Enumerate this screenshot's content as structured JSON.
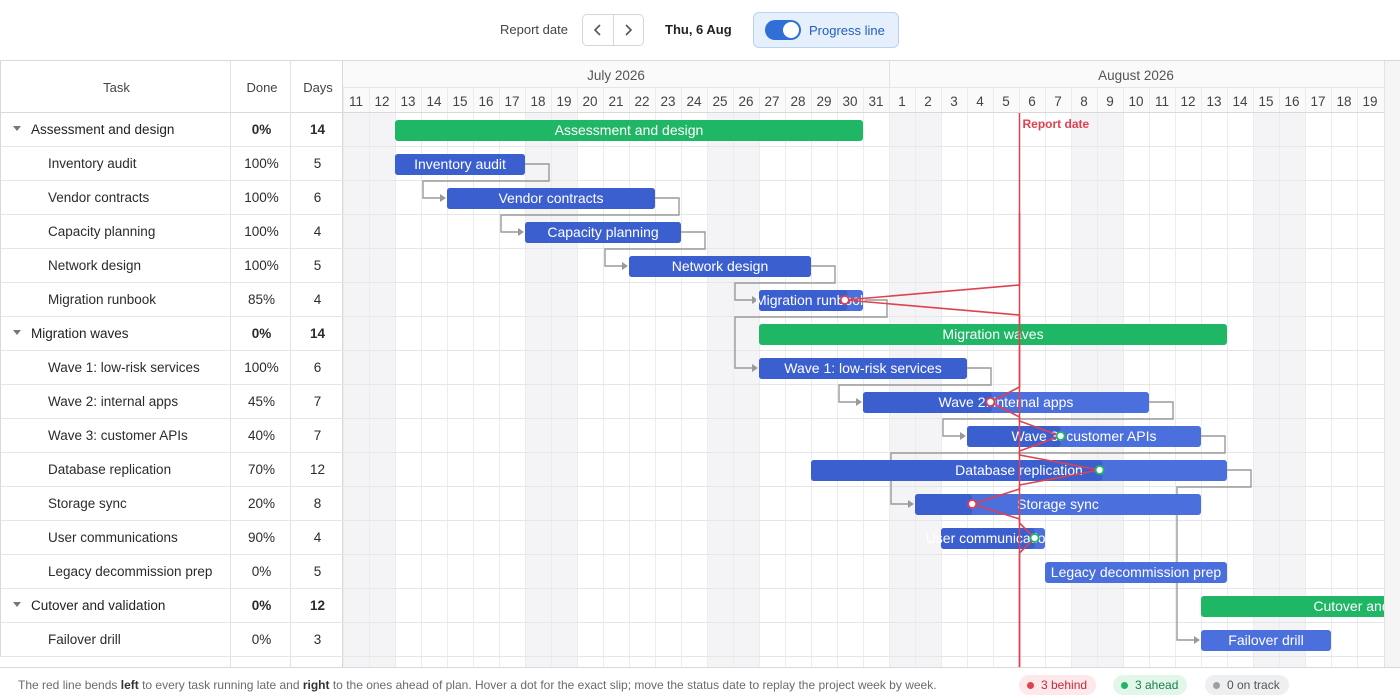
{
  "toolbar": {
    "report_date_label": "Report date",
    "prev_icon": "chevron-left-icon",
    "next_icon": "chevron-right-icon",
    "current_date": "Thu, 6 Aug",
    "progress_toggle_label": "Progress line",
    "progress_toggle_on": true
  },
  "columns": {
    "task": "Task",
    "done": "Done",
    "days": "Days"
  },
  "timeline": {
    "months": [
      {
        "label": "July 2026",
        "start_index": 0,
        "span": 21
      },
      {
        "label": "August 2026",
        "start_index": 21,
        "span": 19
      }
    ],
    "days": [
      "11",
      "12",
      "13",
      "14",
      "15",
      "16",
      "17",
      "18",
      "19",
      "20",
      "21",
      "22",
      "23",
      "24",
      "25",
      "26",
      "27",
      "28",
      "29",
      "30",
      "31",
      "1",
      "2",
      "3",
      "4",
      "5",
      "6",
      "7",
      "8",
      "9",
      "10",
      "11",
      "12",
      "13",
      "14",
      "15",
      "16",
      "17",
      "18",
      "19"
    ],
    "weekend_indices": [
      0,
      1,
      7,
      8,
      14,
      15,
      21,
      22,
      28,
      29,
      35,
      36
    ],
    "report_date_index": 26,
    "report_date_label": "Report date"
  },
  "rows": [
    {
      "id": "g1",
      "type": "group",
      "name": "Assessment and design",
      "done": "0%",
      "days": "14",
      "start": 2,
      "duration": 18,
      "bar_label": "Assessment and design"
    },
    {
      "id": "t1",
      "type": "task",
      "name": "Inventory audit",
      "done": "100%",
      "days": "5",
      "start": 2,
      "duration": 5,
      "progress": 1.0,
      "bar_label": "Inventory audit"
    },
    {
      "id": "t2",
      "type": "task",
      "name": "Vendor contracts",
      "done": "100%",
      "days": "6",
      "start": 4,
      "duration": 8,
      "progress": 1.0,
      "bar_label": "Vendor contracts"
    },
    {
      "id": "t3",
      "type": "task",
      "name": "Capacity planning",
      "done": "100%",
      "days": "4",
      "start": 7,
      "duration": 6,
      "progress": 1.0,
      "bar_label": "Capacity planning"
    },
    {
      "id": "t4",
      "type": "task",
      "name": "Network design",
      "done": "100%",
      "days": "5",
      "start": 11,
      "duration": 7,
      "progress": 1.0,
      "bar_label": "Network design"
    },
    {
      "id": "t5",
      "type": "task",
      "name": "Migration runbook",
      "done": "85%",
      "days": "4",
      "start": 16,
      "duration": 4,
      "progress": 0.85,
      "bar_label": "Migration runbook",
      "status": "behind",
      "dot_index": 19.3
    },
    {
      "id": "g2",
      "type": "group",
      "name": "Migration waves",
      "done": "0%",
      "days": "14",
      "start": 16,
      "duration": 18,
      "bar_label": "Migration waves"
    },
    {
      "id": "t6",
      "type": "task",
      "name": "Wave 1: low-risk services",
      "done": "100%",
      "days": "6",
      "start": 16,
      "duration": 8,
      "progress": 1.0,
      "bar_label": "Wave 1: low-risk services"
    },
    {
      "id": "t7",
      "type": "task",
      "name": "Wave 2: internal apps",
      "done": "45%",
      "days": "7",
      "start": 20,
      "duration": 11,
      "progress": 0.45,
      "bar_label": "Wave 2: internal apps",
      "status": "behind",
      "dot_index": 24.9
    },
    {
      "id": "t8",
      "type": "task",
      "name": "Wave 3: customer APIs",
      "done": "40%",
      "days": "7",
      "start": 24,
      "duration": 9,
      "progress": 0.4,
      "bar_label": "Wave 3: customer APIs",
      "status": "ahead",
      "dot_index": 27.6
    },
    {
      "id": "t9",
      "type": "task",
      "name": "Database replication",
      "done": "70%",
      "days": "12",
      "start": 18,
      "duration": 16,
      "progress": 0.7,
      "bar_label": "Database replication",
      "status": "ahead",
      "dot_index": 29.1
    },
    {
      "id": "t10",
      "type": "task",
      "name": "Storage sync",
      "done": "20%",
      "days": "8",
      "start": 22,
      "duration": 11,
      "progress": 0.2,
      "bar_label": "Storage sync",
      "status": "behind",
      "dot_index": 24.2
    },
    {
      "id": "t11",
      "type": "task",
      "name": "User communications",
      "done": "90%",
      "days": "4",
      "start": 23,
      "duration": 4,
      "progress": 0.9,
      "bar_label": "User communications",
      "status": "ahead",
      "dot_index": 26.6
    },
    {
      "id": "t12",
      "type": "task",
      "name": "Legacy decommission prep",
      "done": "0%",
      "days": "5",
      "start": 27,
      "duration": 7,
      "progress": 0.0,
      "bar_label": "Legacy decommission prep"
    },
    {
      "id": "g3",
      "type": "group",
      "name": "Cutover and validation",
      "done": "0%",
      "days": "12",
      "start": 33,
      "duration": 14,
      "bar_label": "Cutover and validation"
    },
    {
      "id": "t13",
      "type": "task",
      "name": "Failover drill",
      "done": "0%",
      "days": "3",
      "start": 33,
      "duration": 5,
      "progress": 0.0,
      "bar_label": "Failover drill"
    }
  ],
  "dependencies": [
    [
      "t1",
      "t2"
    ],
    [
      "t2",
      "t3"
    ],
    [
      "t3",
      "t4"
    ],
    [
      "t4",
      "t5"
    ],
    [
      "t5",
      "t6"
    ],
    [
      "t6",
      "t7"
    ],
    [
      "t7",
      "t8"
    ],
    [
      "t8",
      "t10"
    ],
    [
      "t9",
      "t13"
    ]
  ],
  "colors": {
    "task_bar": "#4b6fdc",
    "task_progress": "#3c5fd0",
    "group_bar": "#1fb765",
    "progress_line": "#e0414f",
    "weekend": "#f4f4f6",
    "dependency": "#9a9a9a",
    "dot_behind": "#e0414f",
    "dot_ahead": "#1fb765"
  },
  "footer": {
    "text_1": "The red line bends ",
    "text_left": "left",
    "text_2": " to every task running late and ",
    "text_right": "right",
    "text_3": " to the ones ahead of plan. Hover a dot for the exact slip; move the status date to replay the project week by week.",
    "behind_label": "3 behind",
    "ahead_label": "3 ahead",
    "on_track_label": "0 on track"
  }
}
